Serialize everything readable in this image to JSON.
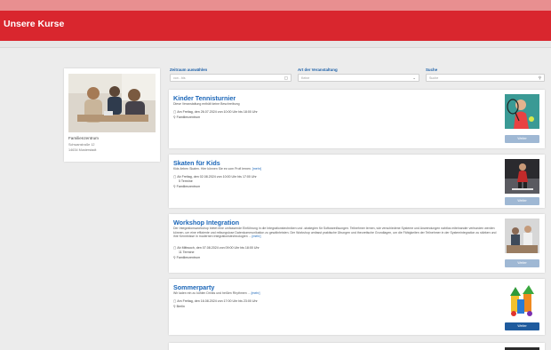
{
  "header": {
    "title": "Unsere Kurse"
  },
  "sidebar": {
    "name": "Familienzentrum",
    "street": "Schwanstraße 12",
    "city": "14634 Musterstadt"
  },
  "filters": {
    "zeitraum": {
      "label": "Zeitraum auswählen",
      "placeholder": "von - bis"
    },
    "art": {
      "label": "Art der Veranstaltung",
      "placeholder": "Keine"
    },
    "suche": {
      "label": "Suche",
      "placeholder": "Suche"
    }
  },
  "courses": [
    {
      "title": "Kinder Tennisturnier",
      "desc": "Diese Veranstaltung enthält keine Beschreibung",
      "more": "",
      "date": "Am Freitag, den 26.07.2024 von 10:00 Uhr bis 18:00 Uhr",
      "count": "",
      "location": "Familienzentrum",
      "button": "Weiter",
      "button_active": false
    },
    {
      "title": "Skaten für Kids",
      "desc": "Kids lieben Skaten. Hier können Sie es vom Profi lernen.",
      "more": "[mehr]",
      "date": "Ab Freitag, den 02.08.2024 von 10:00 Uhr bis 17:00 Uhr",
      "count": "5 Termine",
      "location": "Familienzentrum",
      "button": "Weiter",
      "button_active": false
    },
    {
      "title": "Workshop Integration",
      "desc": "Der Integrationsworkshop bietet eine umfassende Einführung in die Integrationstechniken und -strategien für Softwarelösungen. Teilnehmer lernen, wie verschiedene Systeme und Anwendungen nahtlos miteinander verbunden werden können, um eine effiziente und reibungslose Datenkommunikation zu gewährleisten. Der Workshop umfasst praktische Übungen und theoretische Grundlagen, um die Fähigkeiten der Teilnehmer in der Systemintegration zu stärken und ihre Kenntnisse in modernen Integrationstechnologien ...",
      "more": "[mehr]",
      "date": "Ab Mittwoch, den 07.08.2024 von 09:00 Uhr bis 18:00 Uhr",
      "count": "11 Termine",
      "location": "Familienzentrum",
      "button": "Weiter",
      "button_active": false
    },
    {
      "title": "Sommerparty",
      "desc": "Wir laden ein zu kühlen Drinks und heißen Rhythmen ...",
      "more": "[mehr]",
      "date": "Am Freitag, den 16.08.2024 von 17:00 Uhr bis 23:00 Uhr",
      "count": "",
      "location": "Berlin",
      "button": "Weiter",
      "button_active": true
    }
  ]
}
